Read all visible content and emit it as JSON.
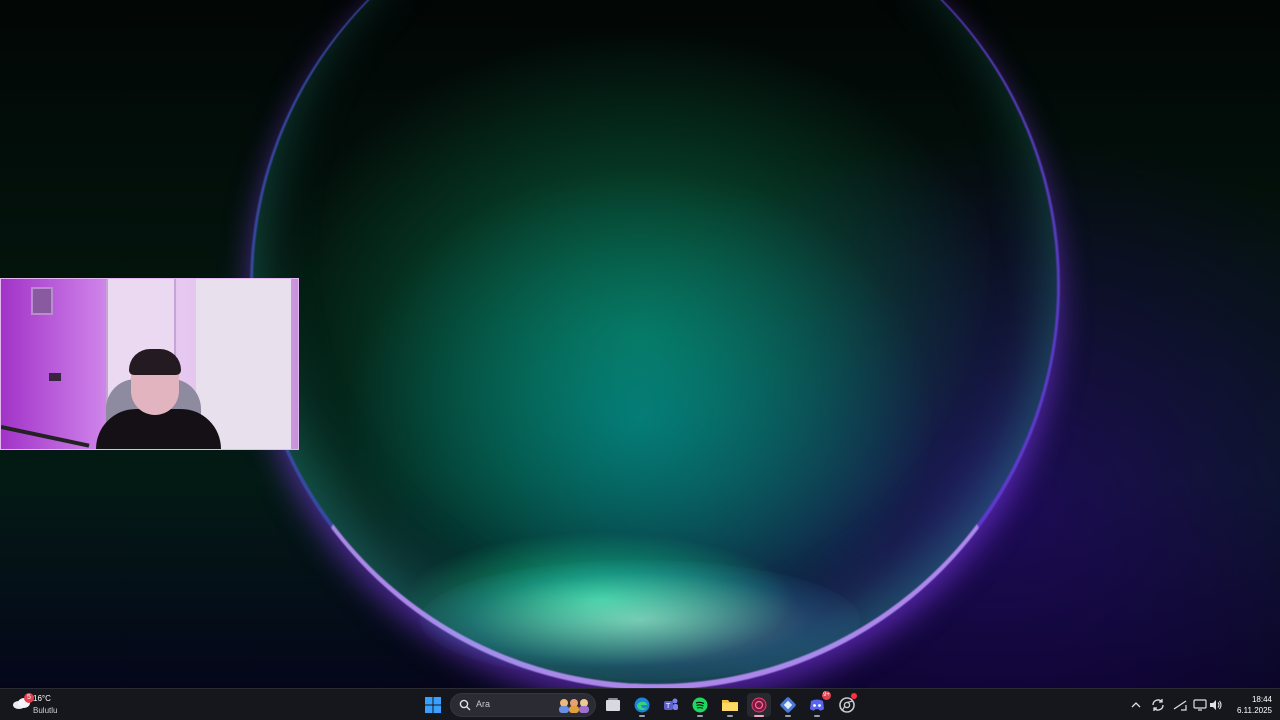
{
  "weather": {
    "temperature": "16°C",
    "condition": "Bulutlu",
    "alert_count": "5"
  },
  "search": {
    "placeholder": "Ara"
  },
  "taskbar": {
    "apps": [
      {
        "name": "start",
        "icon": "windows-logo-icon"
      },
      {
        "name": "task-view",
        "icon": "task-view-icon"
      },
      {
        "name": "edge",
        "icon": "edge-browser-icon"
      },
      {
        "name": "teams",
        "icon": "teams-icon"
      },
      {
        "name": "spotify",
        "icon": "spotify-icon"
      },
      {
        "name": "file-explorer",
        "icon": "folder-icon"
      },
      {
        "name": "recorder",
        "icon": "recorder-icon",
        "active": true
      },
      {
        "name": "app-launcher",
        "icon": "launcher-icon"
      },
      {
        "name": "discord",
        "icon": "discord-icon",
        "badge": "9+"
      },
      {
        "name": "chrome-canary",
        "icon": "chrome-icon"
      }
    ]
  },
  "tray": {
    "icons": [
      "chevron-up-icon",
      "sync-icon",
      "network-icon",
      "display-icon",
      "volume-icon"
    ]
  },
  "clock": {
    "time": "18:44",
    "date": "6.11.2025"
  },
  "colors": {
    "taskbar_bg": "#16171d",
    "accent_active": "#f0a5c8",
    "badge_red": "#e04050"
  }
}
